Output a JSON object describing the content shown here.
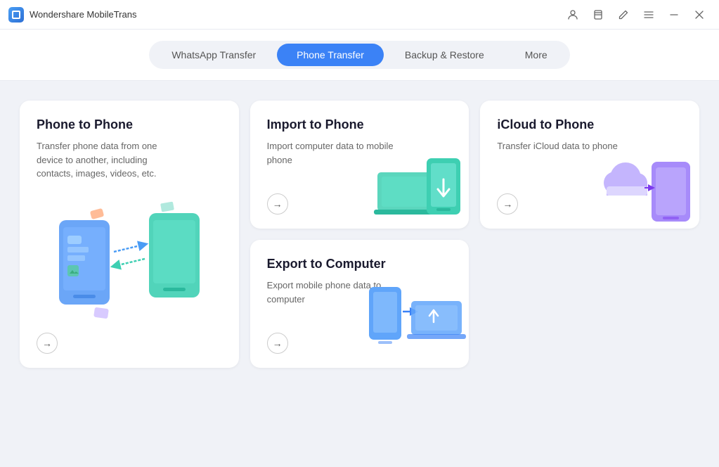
{
  "app": {
    "title": "Wondershare MobileTrans",
    "icon": "app-icon"
  },
  "titlebar": {
    "buttons": {
      "account": "👤",
      "bookmark": "🔖",
      "edit": "✏️",
      "menu": "☰",
      "minimize": "—",
      "close": "✕"
    }
  },
  "nav": {
    "tabs": [
      {
        "id": "whatsapp",
        "label": "WhatsApp Transfer",
        "active": false
      },
      {
        "id": "phone",
        "label": "Phone Transfer",
        "active": true
      },
      {
        "id": "backup",
        "label": "Backup & Restore",
        "active": false
      },
      {
        "id": "more",
        "label": "More",
        "active": false
      }
    ]
  },
  "cards": {
    "phone_to_phone": {
      "title": "Phone to Phone",
      "description": "Transfer phone data from one device to another, including contacts, images, videos, etc.",
      "arrow": "→"
    },
    "import_to_phone": {
      "title": "Import to Phone",
      "description": "Import computer data to mobile phone",
      "arrow": "→"
    },
    "icloud_to_phone": {
      "title": "iCloud to Phone",
      "description": "Transfer iCloud data to phone",
      "arrow": "→"
    },
    "export_to_computer": {
      "title": "Export to Computer",
      "description": "Export mobile phone data to computer",
      "arrow": "→"
    }
  }
}
